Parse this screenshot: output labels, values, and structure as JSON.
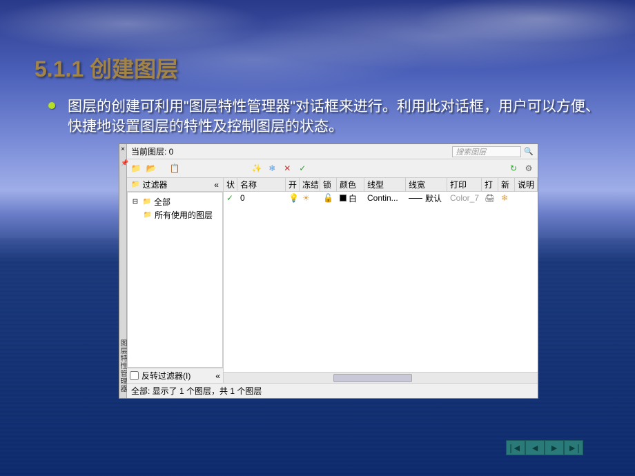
{
  "slide": {
    "title": "5.1.1  创建图层",
    "bullet_text": "图层的创建可利用\"图层特性管理器\"对话框来进行。利用此对话框，用户可以方便、快捷地设置图层的特性及控制图层的状态。"
  },
  "dialog": {
    "vertical_title": "图层特性管理器",
    "current_layer": "当前图层: 0",
    "search_placeholder": "搜索图层",
    "filter_header": "过滤器",
    "collapse_icon": "«",
    "tree": {
      "root": "全部",
      "child": "所有使用的图层"
    },
    "invert_filter": "反转过滤器(I)",
    "headers": {
      "status": "状",
      "name": "名称",
      "on": "开",
      "freeze": "冻结",
      "lock": "锁",
      "color": "颜色",
      "linetype": "线型",
      "lineweight": "线宽",
      "plotstyle": "打印",
      "plot": "打",
      "newvp": "新",
      "desc": "说明"
    },
    "layer": {
      "name": "0",
      "color_name": "白",
      "linetype": "Contin...",
      "lineweight": "默认",
      "plotstyle": "Color_7"
    },
    "status_text": "全部: 显示了 1 个图层，共 1 个图层"
  },
  "icons": {
    "close": "×",
    "pin": "📌",
    "magnifier": "🔍",
    "new_filter": "📁",
    "new_group": "📂",
    "states": "📋",
    "new_layer": "✨",
    "new_vp": "❄",
    "delete": "✕",
    "set_current": "✓",
    "refresh": "↻",
    "settings": "⚙",
    "check": "✓",
    "bulb": "💡",
    "sun": "☀",
    "lock": "🔓",
    "printer": "🖨",
    "vp_freeze": "❄",
    "tree_minus": "⊟",
    "tree_filter": "📁"
  },
  "nav": {
    "first": "|◄",
    "prev": "◄",
    "next": "►",
    "last": "►|"
  }
}
